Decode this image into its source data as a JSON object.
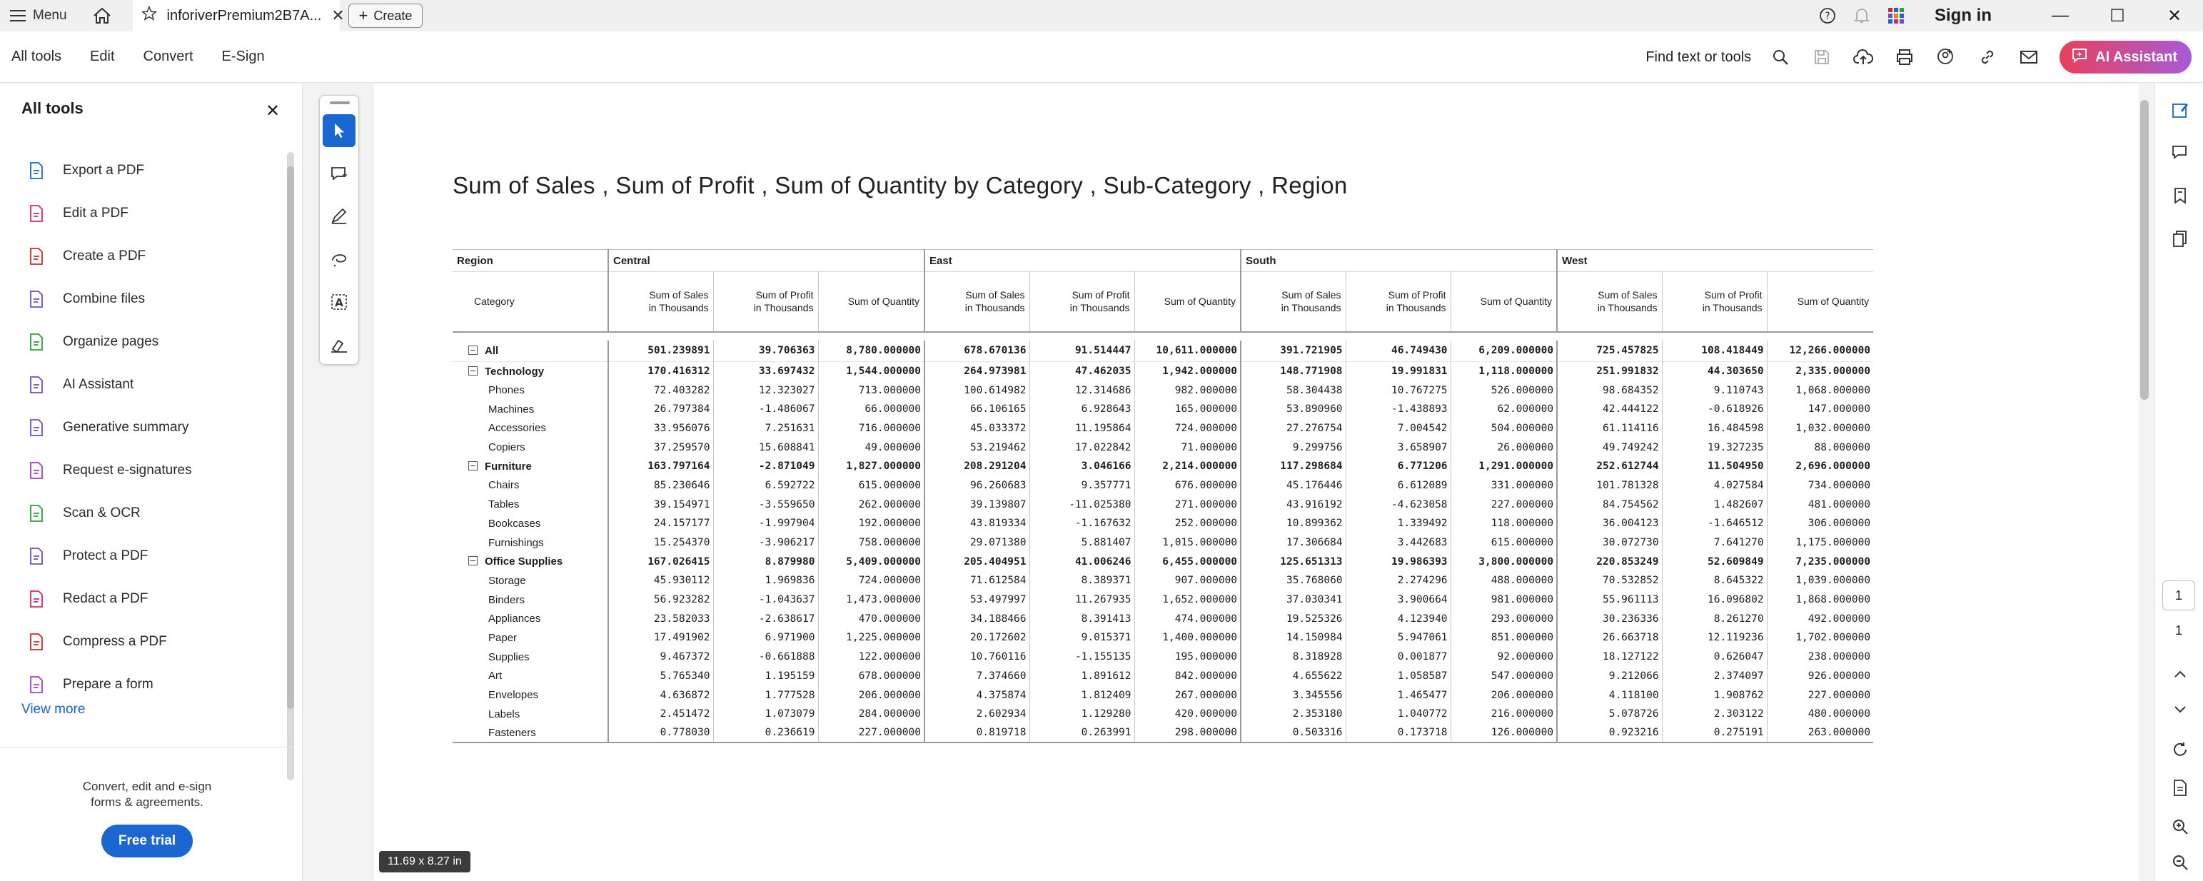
{
  "topbar": {
    "menu_label": "Menu",
    "tab_title": "inforiverPremium2B7A...",
    "create_label": "Create",
    "signin_label": "Sign in"
  },
  "toolbar": {
    "tabs": [
      "All tools",
      "Edit",
      "Convert",
      "E-Sign"
    ],
    "find_label": "Find text or tools",
    "ai_assistant_label": "AI Assistant"
  },
  "left_panel": {
    "title": "All tools",
    "items": [
      {
        "label": "Export a PDF",
        "icon": "export-pdf-icon",
        "color": "#1b66d1"
      },
      {
        "label": "Edit a PDF",
        "icon": "edit-pdf-icon",
        "color": "#d12a6b"
      },
      {
        "label": "Create a PDF",
        "icon": "create-pdf-icon",
        "color": "#d12a2a"
      },
      {
        "label": "Combine files",
        "icon": "combine-files-icon",
        "color": "#6b4fcf"
      },
      {
        "label": "Organize pages",
        "icon": "organize-pages-icon",
        "color": "#2e9e3e"
      },
      {
        "label": "AI Assistant",
        "icon": "ai-assistant-icon",
        "color": "#6b4fcf"
      },
      {
        "label": "Generative summary",
        "icon": "generative-summary-icon",
        "color": "#6b4fcf"
      },
      {
        "label": "Request e-signatures",
        "icon": "request-esignatures-icon",
        "color": "#a13fc4"
      },
      {
        "label": "Scan & OCR",
        "icon": "scan-ocr-icon",
        "color": "#2e9e3e"
      },
      {
        "label": "Protect a PDF",
        "icon": "protect-pdf-icon",
        "color": "#6b4fcf"
      },
      {
        "label": "Redact a PDF",
        "icon": "redact-pdf-icon",
        "color": "#d12a6b"
      },
      {
        "label": "Compress a PDF",
        "icon": "compress-pdf-icon",
        "color": "#d12a2a"
      },
      {
        "label": "Prepare a form",
        "icon": "prepare-form-icon",
        "color": "#a13fc4"
      }
    ],
    "view_more": "View more",
    "footer_line1": "Convert, edit and e-sign",
    "footer_line2": "forms & agreements.",
    "free_trial": "Free trial"
  },
  "document": {
    "title": "Sum of Sales , Sum of Profit , Sum of Quantity by Category , Sub-Category , Region",
    "region_header": "Region",
    "category_header": "Category",
    "regions": [
      "Central",
      "East",
      "South",
      "West"
    ],
    "measures": [
      [
        "Sum of Sales",
        "in Thousands"
      ],
      [
        "Sum of Profit",
        "in Thousands"
      ],
      [
        "Sum of Quantity",
        ""
      ]
    ],
    "rows": [
      {
        "label": "All",
        "kind": "all",
        "values": [
          "501.239891",
          "39.706363",
          "8,780.000000",
          "678.670136",
          "91.514447",
          "10,611.000000",
          "391.721905",
          "46.749430",
          "6,209.000000",
          "725.457825",
          "108.418449",
          "12,266.000000"
        ]
      },
      {
        "label": "Technology",
        "kind": "grp",
        "values": [
          "170.416312",
          "33.697432",
          "1,544.000000",
          "264.973981",
          "47.462035",
          "1,942.000000",
          "148.771908",
          "19.991831",
          "1,118.000000",
          "251.991832",
          "44.303650",
          "2,335.000000"
        ]
      },
      {
        "label": "Phones",
        "kind": "sub",
        "values": [
          "72.403282",
          "12.323027",
          "713.000000",
          "100.614982",
          "12.314686",
          "982.000000",
          "58.304438",
          "10.767275",
          "526.000000",
          "98.684352",
          "9.110743",
          "1,068.000000"
        ]
      },
      {
        "label": "Machines",
        "kind": "sub",
        "values": [
          "26.797384",
          "-1.486067",
          "66.000000",
          "66.106165",
          "6.928643",
          "165.000000",
          "53.890960",
          "-1.438893",
          "62.000000",
          "42.444122",
          "-0.618926",
          "147.000000"
        ]
      },
      {
        "label": "Accessories",
        "kind": "sub",
        "values": [
          "33.956076",
          "7.251631",
          "716.000000",
          "45.033372",
          "11.195864",
          "724.000000",
          "27.276754",
          "7.004542",
          "504.000000",
          "61.114116",
          "16.484598",
          "1,032.000000"
        ]
      },
      {
        "label": "Copiers",
        "kind": "sub",
        "values": [
          "37.259570",
          "15.608841",
          "49.000000",
          "53.219462",
          "17.022842",
          "71.000000",
          "9.299756",
          "3.658907",
          "26.000000",
          "49.749242",
          "19.327235",
          "88.000000"
        ]
      },
      {
        "label": "Furniture",
        "kind": "grp",
        "values": [
          "163.797164",
          "-2.871049",
          "1,827.000000",
          "208.291204",
          "3.046166",
          "2,214.000000",
          "117.298684",
          "6.771206",
          "1,291.000000",
          "252.612744",
          "11.504950",
          "2,696.000000"
        ]
      },
      {
        "label": "Chairs",
        "kind": "sub",
        "values": [
          "85.230646",
          "6.592722",
          "615.000000",
          "96.260683",
          "9.357771",
          "676.000000",
          "45.176446",
          "6.612089",
          "331.000000",
          "101.781328",
          "4.027584",
          "734.000000"
        ]
      },
      {
        "label": "Tables",
        "kind": "sub",
        "values": [
          "39.154971",
          "-3.559650",
          "262.000000",
          "39.139807",
          "-11.025380",
          "271.000000",
          "43.916192",
          "-4.623058",
          "227.000000",
          "84.754562",
          "1.482607",
          "481.000000"
        ]
      },
      {
        "label": "Bookcases",
        "kind": "sub",
        "values": [
          "24.157177",
          "-1.997904",
          "192.000000",
          "43.819334",
          "-1.167632",
          "252.000000",
          "10.899362",
          "1.339492",
          "118.000000",
          "36.004123",
          "-1.646512",
          "306.000000"
        ]
      },
      {
        "label": "Furnishings",
        "kind": "sub",
        "values": [
          "15.254370",
          "-3.906217",
          "758.000000",
          "29.071380",
          "5.881407",
          "1,015.000000",
          "17.306684",
          "3.442683",
          "615.000000",
          "30.072730",
          "7.641270",
          "1,175.000000"
        ]
      },
      {
        "label": "Office Supplies",
        "kind": "grp",
        "values": [
          "167.026415",
          "8.879980",
          "5,409.000000",
          "205.404951",
          "41.006246",
          "6,455.000000",
          "125.651313",
          "19.986393",
          "3,800.000000",
          "220.853249",
          "52.609849",
          "7,235.000000"
        ]
      },
      {
        "label": "Storage",
        "kind": "sub",
        "values": [
          "45.930112",
          "1.969836",
          "724.000000",
          "71.612584",
          "8.389371",
          "907.000000",
          "35.768060",
          "2.274296",
          "488.000000",
          "70.532852",
          "8.645322",
          "1,039.000000"
        ]
      },
      {
        "label": "Binders",
        "kind": "sub",
        "values": [
          "56.923282",
          "-1.043637",
          "1,473.000000",
          "53.497997",
          "11.267935",
          "1,652.000000",
          "37.030341",
          "3.900664",
          "981.000000",
          "55.961113",
          "16.096802",
          "1,868.000000"
        ]
      },
      {
        "label": "Appliances",
        "kind": "sub",
        "values": [
          "23.582033",
          "-2.638617",
          "470.000000",
          "34.188466",
          "8.391413",
          "474.000000",
          "19.525326",
          "4.123940",
          "293.000000",
          "30.236336",
          "8.261270",
          "492.000000"
        ]
      },
      {
        "label": "Paper",
        "kind": "sub",
        "values": [
          "17.491902",
          "6.971900",
          "1,225.000000",
          "20.172602",
          "9.015371",
          "1,400.000000",
          "14.150984",
          "5.947061",
          "851.000000",
          "26.663718",
          "12.119236",
          "1,702.000000"
        ]
      },
      {
        "label": "Supplies",
        "kind": "sub",
        "values": [
          "9.467372",
          "-0.661888",
          "122.000000",
          "10.760116",
          "-1.155135",
          "195.000000",
          "8.318928",
          "0.001877",
          "92.000000",
          "18.127122",
          "0.626047",
          "238.000000"
        ]
      },
      {
        "label": "Art",
        "kind": "sub",
        "values": [
          "5.765340",
          "1.195159",
          "678.000000",
          "7.374660",
          "1.891612",
          "842.000000",
          "4.655622",
          "1.058587",
          "547.000000",
          "9.212066",
          "2.374097",
          "926.000000"
        ]
      },
      {
        "label": "Envelopes",
        "kind": "sub",
        "values": [
          "4.636872",
          "1.777528",
          "206.000000",
          "4.375874",
          "1.812409",
          "267.000000",
          "3.345556",
          "1.465477",
          "206.000000",
          "4.118100",
          "1.908762",
          "227.000000"
        ]
      },
      {
        "label": "Labels",
        "kind": "sub",
        "values": [
          "2.451472",
          "1.073079",
          "284.000000",
          "2.602934",
          "1.129280",
          "420.000000",
          "2.353180",
          "1.040772",
          "216.000000",
          "5.078726",
          "2.303122",
          "480.000000"
        ]
      },
      {
        "label": "Fasteners",
        "kind": "sub",
        "values": [
          "0.778030",
          "0.236619",
          "227.000000",
          "0.819718",
          "0.263991",
          "298.000000",
          "0.503316",
          "0.173718",
          "126.000000",
          "0.923216",
          "0.275191",
          "263.000000"
        ]
      }
    ],
    "page_size_label": "11.69 x 8.27 in"
  },
  "right_panel": {
    "current_page": "1",
    "total_pages": "1"
  },
  "colors": {
    "accent": "#1a67d2",
    "ai_gradient_start": "#e9405a",
    "ai_gradient_end": "#a65bd9"
  }
}
